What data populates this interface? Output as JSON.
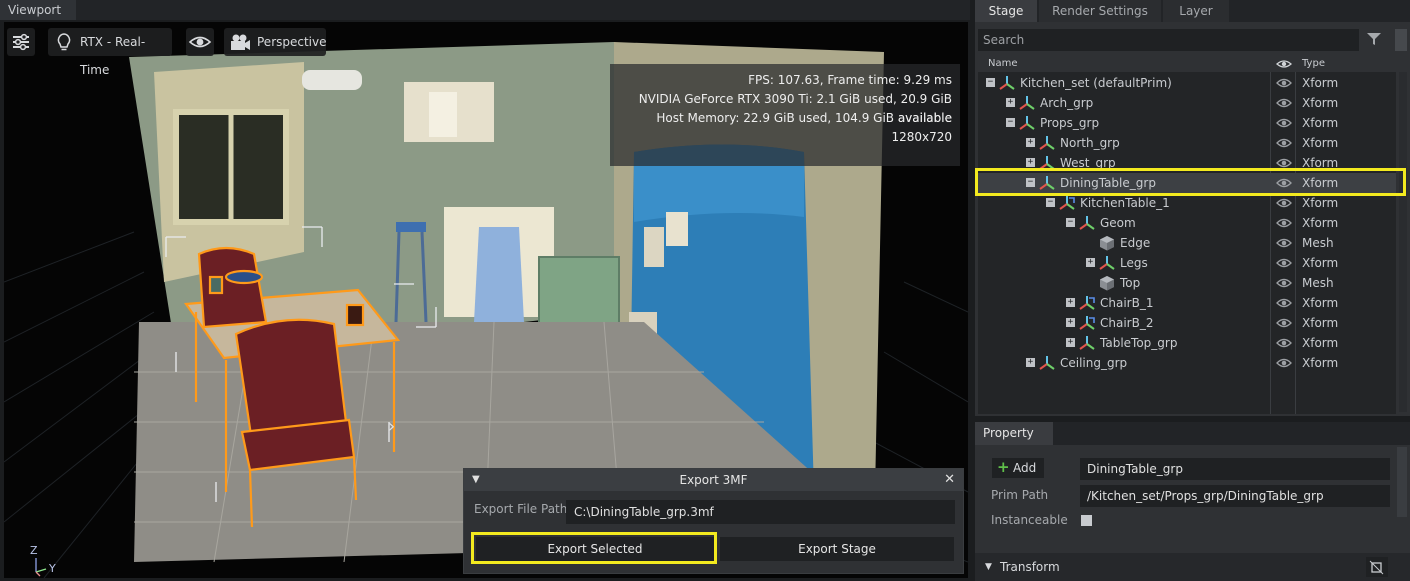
{
  "viewport": {
    "tab_label": "Viewport",
    "toolbar": {
      "renderer": "RTX - Real-Time",
      "camera": "Perspective"
    },
    "stats": [
      "FPS: 107.63, Frame time: 9.29 ms",
      "NVIDIA GeForce RTX 3090 Ti: 2.1 GiB used, 20.9 GiB available",
      "Host Memory: 22.9 GiB used, 104.9 GiB available",
      "1280x720"
    ],
    "axis_labels": {
      "z": "Z",
      "y": "Y"
    }
  },
  "export_dialog": {
    "title": "Export 3MF",
    "path_label": "Export File Path",
    "path_value": "C:\\DiningTable_grp.3mf",
    "export_selected": "Export Selected",
    "export_stage": "Export Stage",
    "highlight_color": "#f3ea1f"
  },
  "right_tabs": [
    "Stage",
    "Render Settings",
    "Layer"
  ],
  "stage": {
    "search_placeholder": "Search",
    "columns": {
      "name": "Name",
      "type": "Type"
    },
    "rows": [
      {
        "name": "Kitchen_set (defaultPrim)",
        "type": "Xform",
        "expander": "−",
        "icon": "xform-icon"
      },
      {
        "name": "Arch_grp",
        "type": "Xform",
        "expander": "+",
        "icon": "xform-icon"
      },
      {
        "name": "Props_grp",
        "type": "Xform",
        "expander": "−",
        "icon": "xform-icon"
      },
      {
        "name": "North_grp",
        "type": "Xform",
        "expander": "+",
        "icon": "xform-icon"
      },
      {
        "name": "West_grp",
        "type": "Xform",
        "expander": "+",
        "icon": "xform-icon"
      },
      {
        "name": "DiningTable_grp",
        "type": "Xform",
        "expander": "−",
        "icon": "xform-icon",
        "selected": true
      },
      {
        "name": "KitchenTable_1",
        "type": "Xform",
        "expander": "−",
        "icon": "xform-ref-icon"
      },
      {
        "name": "Geom",
        "type": "Xform",
        "expander": "−",
        "icon": "xform-icon"
      },
      {
        "name": "Edge",
        "type": "Mesh",
        "expander": "",
        "icon": "mesh-cube-icon"
      },
      {
        "name": "Legs",
        "type": "Xform",
        "expander": "+",
        "icon": "xform-icon"
      },
      {
        "name": "Top",
        "type": "Mesh",
        "expander": "",
        "icon": "mesh-cube-icon"
      },
      {
        "name": "ChairB_1",
        "type": "Xform",
        "expander": "+",
        "icon": "xform-ref-icon"
      },
      {
        "name": "ChairB_2",
        "type": "Xform",
        "expander": "+",
        "icon": "xform-ref-icon"
      },
      {
        "name": "TableTop_grp",
        "type": "Xform",
        "expander": "+",
        "icon": "xform-icon"
      },
      {
        "name": "Ceiling_grp",
        "type": "Xform",
        "expander": "+",
        "icon": "xform-icon"
      }
    ]
  },
  "property": {
    "tab_label": "Property",
    "add_label": "Add",
    "name_value": "DiningTable_grp",
    "prim_path_label": "Prim Path",
    "prim_path_value": "/Kitchen_set/Props_grp/DiningTable_grp",
    "instanceable_label": "Instanceable",
    "transform_label": "Transform"
  }
}
